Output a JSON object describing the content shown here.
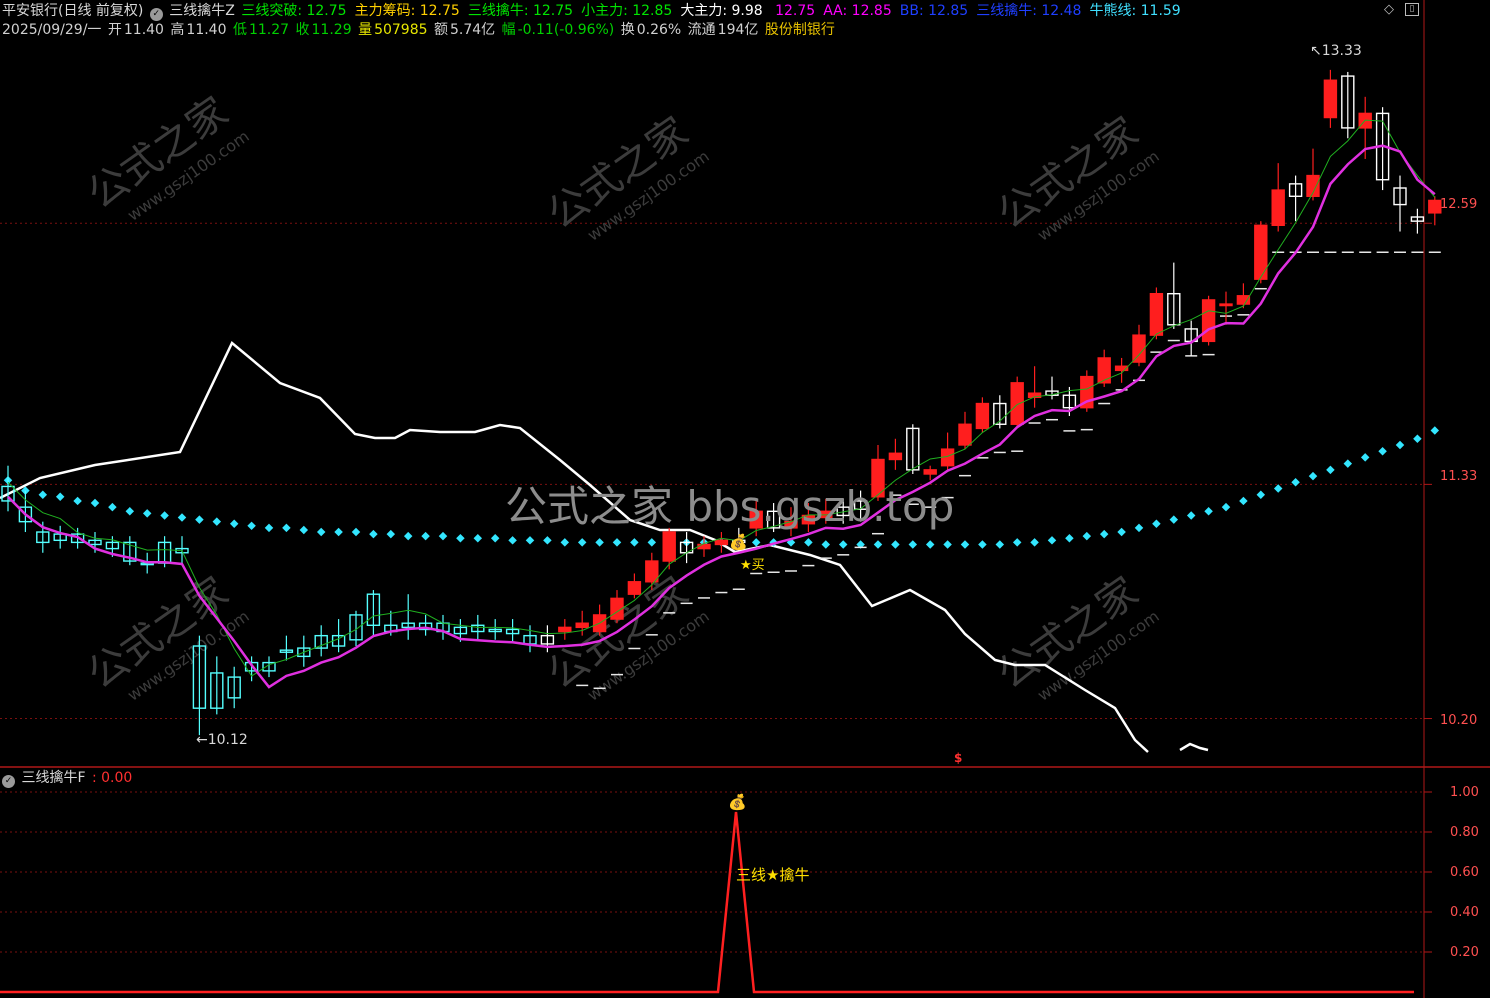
{
  "header1": {
    "stock": "平安银行(日线 前复权)",
    "indicator": "三线擒牛Z",
    "items": [
      {
        "label": "三线突破:",
        "value": "12.75",
        "color": "#00e400"
      },
      {
        "label": "主力筹码:",
        "value": "12.75",
        "color": "#ffd000"
      },
      {
        "label": "三线擒牛:",
        "value": "12.75",
        "color": "#00e400"
      },
      {
        "label": "小主力:",
        "value": "12.85",
        "color": "#00e400"
      },
      {
        "label": "大主力:",
        "value": "9.98",
        "color": "#ffffff"
      },
      {
        "label": "",
        "value": "12.75",
        "color": "#ff00ff"
      },
      {
        "label": "AA:",
        "value": "12.85",
        "color": "#ff00ff"
      },
      {
        "label": "BB:",
        "value": "12.85",
        "color": "#1f3fff"
      },
      {
        "label": "三线擒牛:",
        "value": "12.48",
        "color": "#1f3fff"
      },
      {
        "label": "牛熊线:",
        "value": "11.59",
        "color": "#40e0ff"
      }
    ]
  },
  "header2": {
    "date": "2025/09/29/一",
    "open_label": "开",
    "open": "11.40",
    "high_label": "高",
    "high": "11.40",
    "low_label": "低",
    "low": "11.27",
    "close_label": "收",
    "close": "11.29",
    "vol_label": "量",
    "vol": "507985",
    "amt_label": "额",
    "amt": "5.74亿",
    "chg_label": "幅",
    "chg": "-0.11(-0.96%)",
    "turn_label": "换",
    "turn": "0.26%",
    "float_label": "流通",
    "float": "194亿",
    "sector": "股份制银行"
  },
  "price_axis": [
    "12.59",
    "11.33",
    "10.20"
  ],
  "annotations": {
    "high": "13.33",
    "low": "10.12",
    "buy": "买"
  },
  "watermark": {
    "site": "公式之家",
    "url": "www.gszj100.com",
    "center": "公式之家 bbs.gszb.top"
  },
  "lower_panel": {
    "title": "三线擒牛F",
    "value": "0.00",
    "axis": [
      "1.00",
      "0.80",
      "0.60",
      "0.40",
      "0.20"
    ],
    "signal_label": "三线★擒牛"
  },
  "colors": {
    "up": "#ff1e1e",
    "down": "#54ffff",
    "ma_magenta": "#e030e0",
    "dots": "#33e6ff",
    "white_line": "#ffffff",
    "grid": "#8a1010"
  },
  "chart_data": {
    "type": "candlestick",
    "ylim": [
      10.0,
      13.45
    ],
    "candles": [
      [
        11.25,
        11.32,
        11.42,
        11.2
      ],
      [
        11.22,
        11.15,
        11.3,
        11.1
      ],
      [
        11.1,
        11.05,
        11.15,
        11.0
      ],
      [
        11.09,
        11.06,
        11.13,
        11.02
      ],
      [
        11.09,
        11.05,
        11.12,
        11.02
      ],
      [
        11.06,
        11.04,
        11.1,
        11.0
      ],
      [
        11.05,
        11.02,
        11.08,
        10.98
      ],
      [
        11.05,
        10.96,
        11.08,
        10.94
      ],
      [
        10.95,
        10.95,
        11.0,
        10.9
      ],
      [
        10.95,
        11.05,
        11.08,
        10.93
      ],
      [
        11.02,
        11.0,
        11.08,
        10.95
      ],
      [
        10.55,
        10.25,
        10.6,
        10.12
      ],
      [
        10.25,
        10.42,
        10.5,
        10.22
      ],
      [
        10.3,
        10.4,
        10.45,
        10.25
      ],
      [
        10.43,
        10.47,
        10.5,
        10.38
      ],
      [
        10.43,
        10.47,
        10.5,
        10.4
      ],
      [
        10.53,
        10.52,
        10.6,
        10.48
      ],
      [
        10.5,
        10.54,
        10.6,
        10.45
      ],
      [
        10.54,
        10.6,
        10.65,
        10.5
      ],
      [
        10.55,
        10.6,
        10.68,
        10.52
      ],
      [
        10.58,
        10.7,
        10.72,
        10.55
      ],
      [
        10.65,
        10.8,
        10.82,
        10.6
      ],
      [
        10.62,
        10.65,
        10.72,
        10.6
      ],
      [
        10.64,
        10.66,
        10.8,
        10.58
      ],
      [
        10.66,
        10.63,
        10.7,
        10.6
      ],
      [
        10.66,
        10.62,
        10.7,
        10.58
      ],
      [
        10.64,
        10.61,
        10.68,
        10.57
      ],
      [
        10.65,
        10.62,
        10.7,
        10.58
      ],
      [
        10.62,
        10.63,
        10.68,
        10.58
      ],
      [
        10.63,
        10.61,
        10.68,
        10.57
      ],
      [
        10.6,
        10.56,
        10.65,
        10.52
      ],
      [
        10.6,
        10.56,
        10.65,
        10.52
      ],
      [
        10.62,
        10.64,
        10.68,
        10.58
      ],
      [
        10.64,
        10.66,
        10.72,
        10.6
      ],
      [
        10.62,
        10.7,
        10.75,
        10.6
      ],
      [
        10.68,
        10.78,
        10.82,
        10.66
      ],
      [
        10.8,
        10.86,
        10.9,
        10.78
      ],
      [
        10.86,
        10.96,
        11.0,
        10.82
      ],
      [
        10.96,
        11.1,
        11.12,
        10.92
      ],
      [
        11.05,
        11.0,
        11.1,
        10.95
      ],
      [
        11.02,
        11.04,
        11.08,
        10.98
      ],
      [
        11.04,
        11.06,
        11.1,
        11.0
      ],
      [
        11.06,
        11.05,
        11.12,
        11.0
      ],
      [
        11.12,
        11.2,
        11.25,
        11.08
      ],
      [
        11.2,
        11.12,
        11.24,
        11.1
      ],
      [
        11.12,
        11.15,
        11.22,
        11.08
      ],
      [
        11.14,
        11.18,
        11.24,
        11.1
      ],
      [
        11.17,
        11.2,
        11.26,
        11.14
      ],
      [
        11.22,
        11.18,
        11.26,
        11.14
      ],
      [
        11.25,
        11.21,
        11.3,
        11.15
      ],
      [
        11.27,
        11.45,
        11.52,
        11.25
      ],
      [
        11.45,
        11.48,
        11.55,
        11.4
      ],
      [
        11.6,
        11.4,
        11.62,
        11.38
      ],
      [
        11.38,
        11.4,
        11.42,
        11.35
      ],
      [
        11.42,
        11.5,
        11.58,
        11.4
      ],
      [
        11.52,
        11.62,
        11.68,
        11.5
      ],
      [
        11.6,
        11.72,
        11.75,
        11.58
      ],
      [
        11.72,
        11.62,
        11.76,
        11.6
      ],
      [
        11.62,
        11.82,
        11.85,
        11.6
      ],
      [
        11.75,
        11.77,
        11.9,
        11.7
      ],
      [
        11.78,
        11.76,
        11.85,
        11.74
      ],
      [
        11.76,
        11.7,
        11.8,
        11.66
      ],
      [
        11.7,
        11.85,
        11.88,
        11.68
      ],
      [
        11.82,
        11.94,
        11.98,
        11.8
      ],
      [
        11.88,
        11.9,
        11.94,
        11.82
      ],
      [
        11.92,
        12.05,
        12.1,
        11.9
      ],
      [
        12.05,
        12.25,
        12.28,
        12.03
      ],
      [
        12.25,
        12.1,
        12.4,
        12.08
      ],
      [
        12.08,
        12.02,
        12.12,
        11.95
      ],
      [
        12.02,
        12.22,
        12.24,
        12.0
      ],
      [
        12.2,
        12.2,
        12.26,
        12.1
      ],
      [
        12.2,
        12.24,
        12.3,
        12.18
      ],
      [
        12.32,
        12.58,
        12.6,
        12.3
      ],
      [
        12.58,
        12.75,
        12.88,
        12.55
      ],
      [
        12.78,
        12.72,
        12.82,
        12.6
      ],
      [
        12.72,
        12.82,
        12.95,
        12.7
      ],
      [
        13.1,
        13.28,
        13.33,
        13.05
      ],
      [
        13.3,
        13.05,
        13.32,
        13.0
      ],
      [
        13.05,
        13.12,
        13.2,
        12.9
      ],
      [
        13.12,
        12.8,
        13.15,
        12.75
      ],
      [
        12.76,
        12.68,
        12.82,
        12.55
      ],
      [
        12.62,
        12.6,
        12.66,
        12.54
      ],
      [
        12.64,
        12.7,
        12.72,
        12.58
      ]
    ],
    "bull_bear_line": [
      11.35,
      11.3,
      11.28,
      11.27,
      11.25,
      11.24,
      11.22,
      11.2,
      11.19,
      11.18,
      11.17,
      11.16,
      11.15,
      11.14,
      11.13,
      11.12,
      11.12,
      11.11,
      11.1,
      11.1,
      11.1,
      11.09,
      11.09,
      11.08,
      11.08,
      11.08,
      11.07,
      11.07,
      11.07,
      11.06,
      11.06,
      11.06,
      11.05,
      11.05,
      11.05,
      11.05,
      11.05,
      11.05,
      11.05,
      11.05,
      11.05,
      11.05,
      11.05,
      11.05,
      11.05,
      11.05,
      11.05,
      11.04,
      11.04,
      11.04,
      11.04,
      11.04,
      11.04,
      11.04,
      11.04,
      11.04,
      11.04,
      11.04,
      11.05,
      11.05,
      11.06,
      11.07,
      11.08,
      11.09,
      11.1,
      11.12,
      11.14,
      11.16,
      11.18,
      11.2,
      11.22,
      11.25,
      11.28,
      11.31,
      11.34,
      11.37,
      11.4,
      11.43,
      11.46,
      11.49,
      11.52,
      11.55,
      11.59
    ]
  }
}
